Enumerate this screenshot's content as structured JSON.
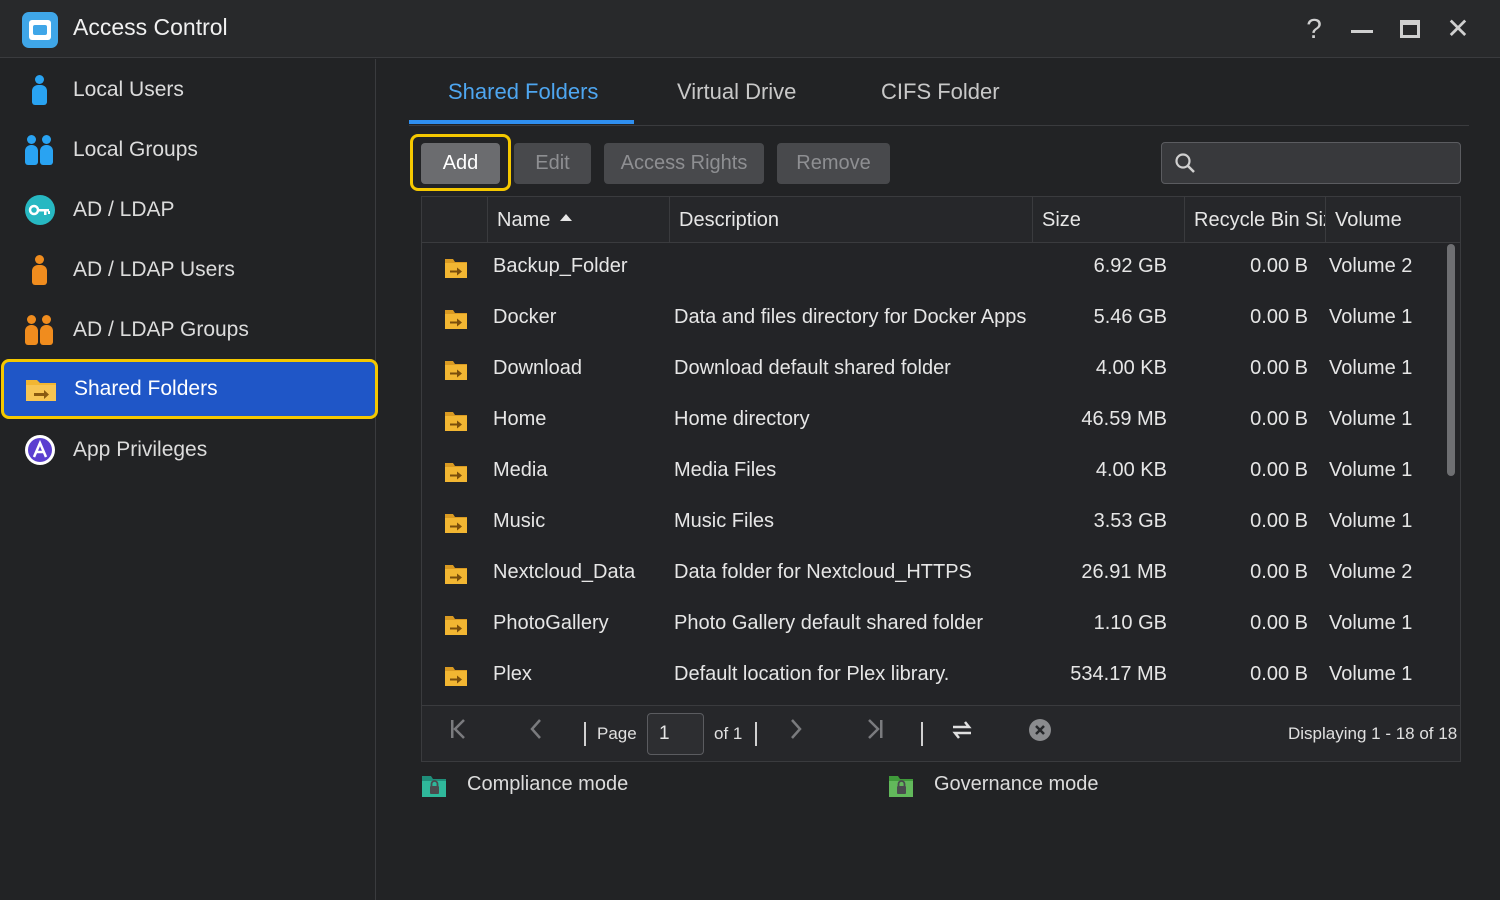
{
  "window": {
    "title": "Access Control",
    "help_icon": "?",
    "minimize_icon": "—",
    "maximize_icon": "☐",
    "close_icon": "✕"
  },
  "sidebar": {
    "items": [
      {
        "label": "Local Users",
        "icon": "user-icon",
        "active": false
      },
      {
        "label": "Local Groups",
        "icon": "group-icon",
        "active": false
      },
      {
        "label": "AD / LDAP",
        "icon": "key-icon",
        "active": false
      },
      {
        "label": "AD / LDAP Users",
        "icon": "ldap-user-icon",
        "active": false
      },
      {
        "label": "AD / LDAP Groups",
        "icon": "ldap-group-icon",
        "active": false
      },
      {
        "label": "Shared Folders",
        "icon": "shared-folder-icon",
        "active": true
      },
      {
        "label": "App Privileges",
        "icon": "app-privileges-icon",
        "active": false
      }
    ]
  },
  "tabs": [
    {
      "label": "Shared Folders",
      "active": true
    },
    {
      "label": "Virtual Drive",
      "active": false
    },
    {
      "label": "CIFS Folder",
      "active": false
    }
  ],
  "toolbar": {
    "add_label": "Add",
    "edit_label": "Edit",
    "access_rights_label": "Access Rights",
    "remove_label": "Remove",
    "search_placeholder": ""
  },
  "table": {
    "columns": [
      "Name",
      "Description",
      "Size",
      "Recycle Bin Size",
      "Volume"
    ],
    "rows": [
      {
        "name": "Backup_Folder",
        "description": "",
        "size": "6.92 GB",
        "recycle": "0.00 B",
        "volume": "Volume 2"
      },
      {
        "name": "Docker",
        "description": "Data and files directory for Docker Apps",
        "size": "5.46 GB",
        "recycle": "0.00 B",
        "volume": "Volume 1"
      },
      {
        "name": "Download",
        "description": "Download default shared folder",
        "size": "4.00 KB",
        "recycle": "0.00 B",
        "volume": "Volume 1"
      },
      {
        "name": "Home",
        "description": "Home directory",
        "size": "46.59 MB",
        "recycle": "0.00 B",
        "volume": "Volume 1"
      },
      {
        "name": "Media",
        "description": "Media Files",
        "size": "4.00 KB",
        "recycle": "0.00 B",
        "volume": "Volume 1"
      },
      {
        "name": "Music",
        "description": "Music Files",
        "size": "3.53 GB",
        "recycle": "0.00 B",
        "volume": "Volume 1"
      },
      {
        "name": "Nextcloud_Data",
        "description": "Data folder for Nextcloud_HTTPS",
        "size": "26.91 MB",
        "recycle": "0.00 B",
        "volume": "Volume 2"
      },
      {
        "name": "PhotoGallery",
        "description": "Photo Gallery default shared folder",
        "size": "1.10 GB",
        "recycle": "0.00 B",
        "volume": "Volume 1"
      },
      {
        "name": "Plex",
        "description": "Default location for Plex library.",
        "size": "534.17 MB",
        "recycle": "0.00 B",
        "volume": "Volume 1"
      }
    ]
  },
  "pager": {
    "page_label": "Page",
    "page_value": "1",
    "of_label": "of 1",
    "display_text": "Displaying 1 - 18 of 18"
  },
  "legend": {
    "compliance": "Compliance mode",
    "governance": "Governance mode"
  },
  "colors": {
    "accent": "#2f8ff0",
    "active_nav": "#1f56c7",
    "highlight": "#f5c800",
    "folder": "#f2b632"
  }
}
